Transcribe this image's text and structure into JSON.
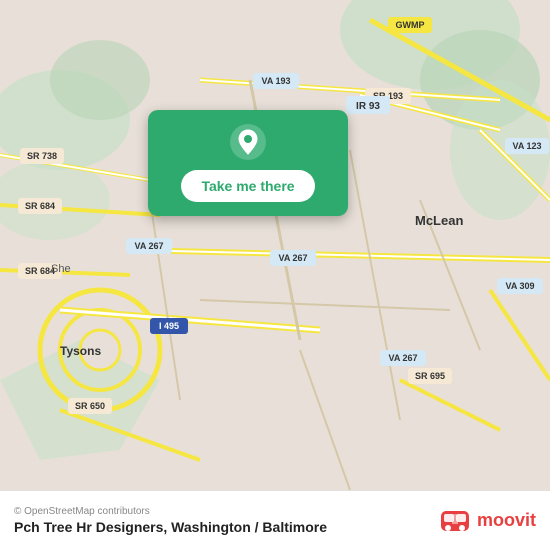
{
  "map": {
    "attribution": "© OpenStreetMap contributors",
    "background_color": "#e8e0d8"
  },
  "popup": {
    "button_label": "Take me there",
    "pin_icon": "location-pin-icon"
  },
  "footer": {
    "attribution": "© OpenStreetMap contributors",
    "location_name": "Pch Tree Hr Designers, Washington / Baltimore",
    "moovit_label": "moovit"
  },
  "road_labels": {
    "ir93": "IR 93",
    "she": "She",
    "gwmp": "GWMP",
    "va193": "VA 193",
    "sr193": "SR 193",
    "va123": "VA 123",
    "sr738": "SR 738",
    "sr684_top": "SR 684",
    "sr684_bot": "SR 684",
    "va267": "VA 267",
    "va267b": "VA 267",
    "va267c": "VA 267",
    "i495": "I 495",
    "sr650": "SR 650",
    "sr695": "SR 695",
    "va309": "VA 309",
    "mclean": "McLean",
    "tysons": "Tysons"
  },
  "colors": {
    "map_bg": "#e8e0d8",
    "green_area": "#c8e6c9",
    "road_yellow": "#f5e642",
    "road_white": "#ffffff",
    "popup_green": "#2eaa6e",
    "moovit_red": "#e84040"
  }
}
